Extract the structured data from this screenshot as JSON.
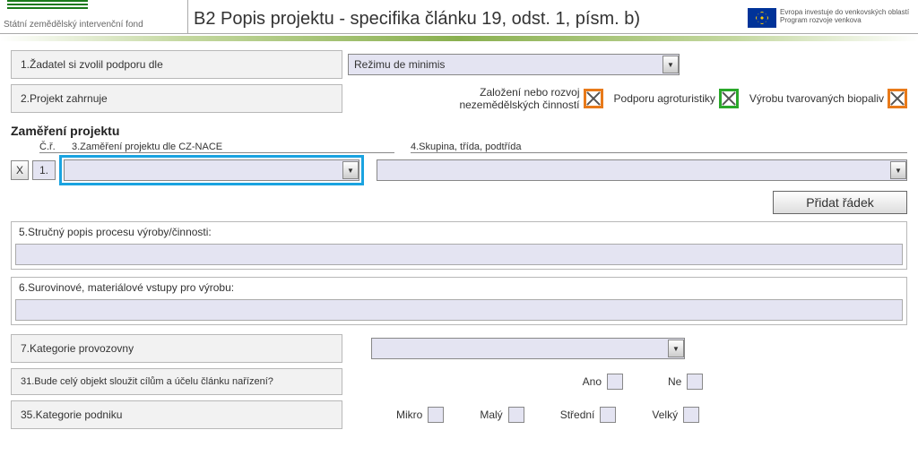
{
  "header": {
    "agency_name": "Státní zemědělský intervenční fond",
    "page_title": "B2 Popis projektu - specifika článku 19, odst. 1, písm. b)",
    "eu_line1": "Evropa investuje do venkovských oblastí",
    "eu_line2": "Program rozvoje venkova"
  },
  "field1": {
    "label": "1.Žadatel si zvolil podporu dle",
    "value": "Režimu de minimis"
  },
  "field2": {
    "label": "2.Projekt zahrnuje",
    "opt1": "Založení nebo rozvoj nezemědělských činností",
    "opt2": "Podporu agroturistiky",
    "opt3": "Výrobu tvarovaných biopaliv"
  },
  "focus": {
    "section_title": "Zaměření projektu",
    "col_cr": "Č.ř.",
    "col_3": "3.Zaměření projektu dle CZ-NACE",
    "col_4": "4.Skupina, třída, podtřída",
    "row_num": "1.",
    "xlabel": "X",
    "add_row": "Přidat řádek"
  },
  "field5": {
    "label": "5.Stručný popis procesu výroby/činnosti:"
  },
  "field6": {
    "label": "6.Surovinové, materiálové vstupy pro výrobu:"
  },
  "field7": {
    "label": "7.Kategorie provozovny"
  },
  "field31": {
    "label": "31.Bude celý objekt sloužit cílům a účelu článku nařízení?",
    "ano": "Ano",
    "ne": "Ne"
  },
  "field35": {
    "label": "35.Kategorie podniku",
    "s1": "Mikro",
    "s2": "Malý",
    "s3": "Střední",
    "s4": "Velký"
  }
}
